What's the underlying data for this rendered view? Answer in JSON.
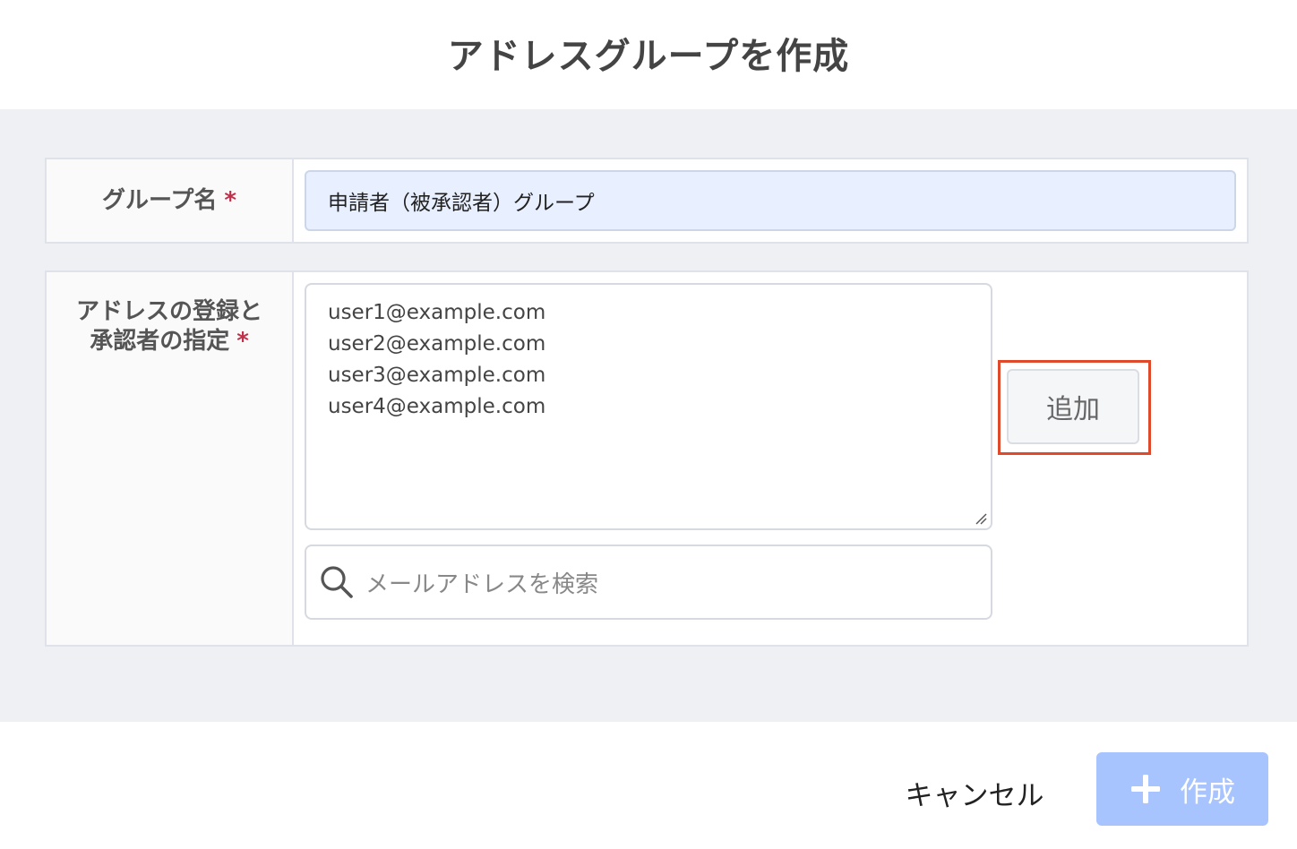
{
  "dialog": {
    "title": "アドレスグループを作成"
  },
  "form": {
    "group_name": {
      "label": "グループ名",
      "required_mark": "*",
      "value": "申請者（被承認者）グループ"
    },
    "addresses": {
      "label_line1": "アドレスの登録と",
      "label_line2": "承認者の指定",
      "required_mark": "*",
      "emails": [
        "user1@example.com",
        "user2@example.com",
        "user3@example.com",
        "user4@example.com"
      ],
      "add_button_label": "追加",
      "search_placeholder": "メールアドレスを検索"
    }
  },
  "footer": {
    "cancel_label": "キャンセル",
    "create_label": "作成"
  },
  "colors": {
    "accent_highlight": "#e04a2c",
    "create_button": "#a8c4ff",
    "required": "#c0304a",
    "name_input_bg": "#e8efff"
  },
  "icons": {
    "search": "search-icon",
    "plus": "plus-icon",
    "resize": "resize-grip-icon"
  }
}
